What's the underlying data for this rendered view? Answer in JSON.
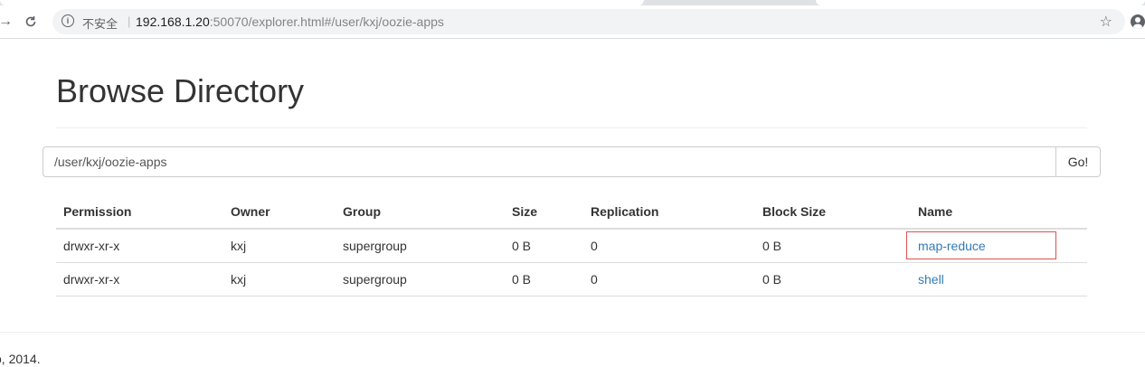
{
  "browser": {
    "security_label": "不安全",
    "url_host": "192.168.1.20",
    "url_rest": ":50070/explorer.html#/user/kxj/oozie-apps"
  },
  "page": {
    "title": "Browse Directory",
    "path_value": "/user/kxj/oozie-apps",
    "go_label": "Go!"
  },
  "table": {
    "headers": [
      "Permission",
      "Owner",
      "Group",
      "Size",
      "Replication",
      "Block Size",
      "Name"
    ],
    "rows": [
      {
        "permission": "drwxr-xr-x",
        "owner": "kxj",
        "group": "supergroup",
        "size": "0 B",
        "replication": "0",
        "block_size": "0 B",
        "name": "map-reduce"
      },
      {
        "permission": "drwxr-xr-x",
        "owner": "kxj",
        "group": "supergroup",
        "size": "0 B",
        "replication": "0",
        "block_size": "0 B",
        "name": "shell"
      }
    ]
  },
  "footer": {
    "text": "o, 2014."
  },
  "colors": {
    "link": "#337ab7",
    "highlight_border": "#d9534f"
  }
}
